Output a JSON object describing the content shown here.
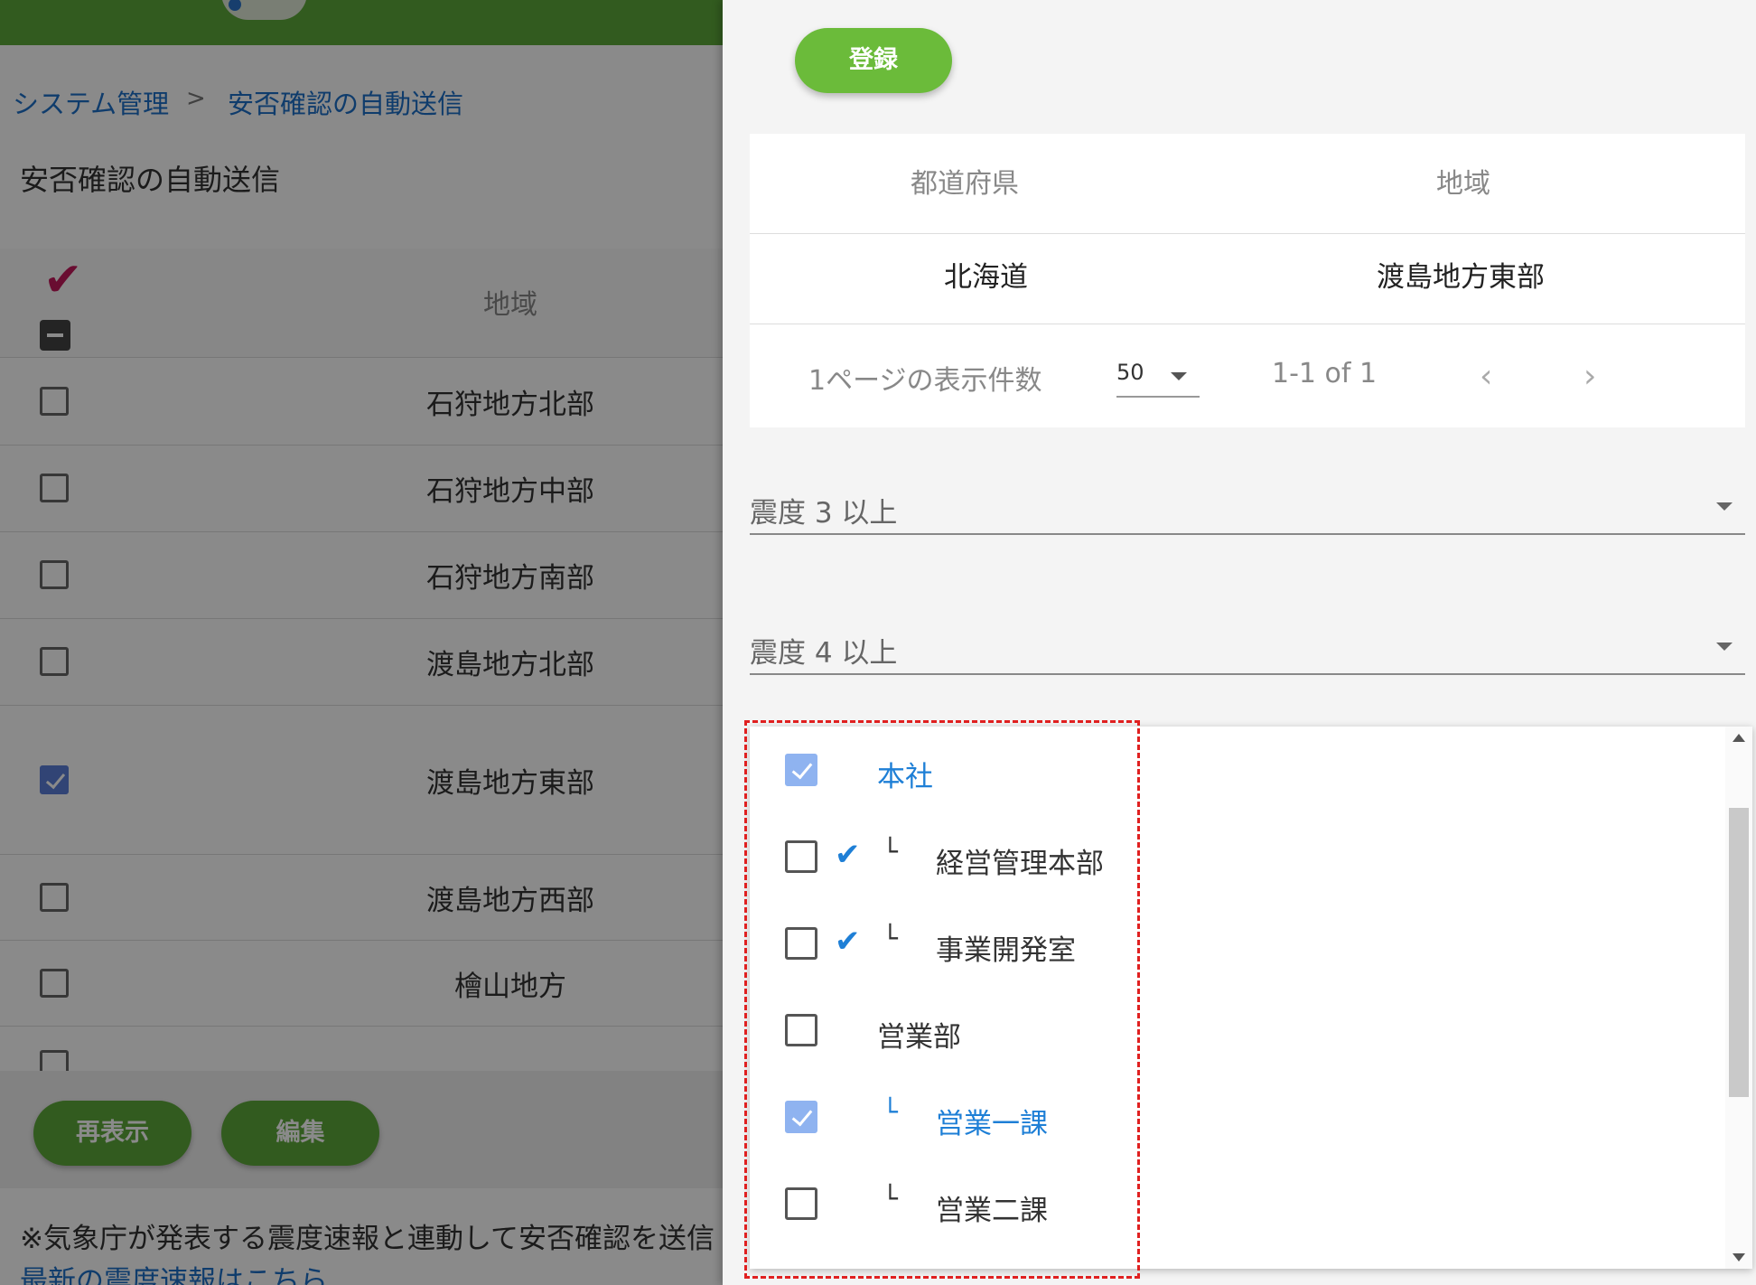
{
  "left": {
    "breadcrumb": [
      "システム管理",
      ">",
      "安否確認の自動送信"
    ],
    "page_title": "安否確認の自動送信",
    "table_header_region": "地域",
    "rows": [
      {
        "label": "石狩地方北部",
        "checked": false
      },
      {
        "label": "石狩地方中部",
        "checked": false
      },
      {
        "label": "石狩地方南部",
        "checked": false
      },
      {
        "label": "渡島地方北部",
        "checked": false
      },
      {
        "label": "渡島地方東部",
        "checked": true
      },
      {
        "label": "渡島地方西部",
        "checked": false
      },
      {
        "label": "檜山地方",
        "checked": false
      }
    ],
    "buttons": {
      "refresh": "再表示",
      "edit": "編集"
    },
    "note": "※気象庁が発表する震度速報と連動して安否確認を送信",
    "link": "最新の震度速報はこちら"
  },
  "right": {
    "register_button": "登録",
    "table": {
      "headers": [
        "都道府県",
        "地域"
      ],
      "rows": [
        [
          "北海道",
          "渡島地方東部"
        ]
      ],
      "rows_per_page_label": "1ページの表示件数",
      "rows_per_page_value": "50",
      "range": "1-1 of 1",
      "prev_icon": "‹",
      "next_icon": "›"
    },
    "selects": [
      "震度 3 以上",
      "震度 4 以上"
    ],
    "menu_items": [
      {
        "label": "本社",
        "checked": true,
        "auto_tick": false,
        "tree": "",
        "highlight": true
      },
      {
        "label": "経営管理本部",
        "checked": false,
        "auto_tick": true,
        "tree": "└",
        "highlight": false
      },
      {
        "label": "事業開発室",
        "checked": false,
        "auto_tick": true,
        "tree": "└",
        "highlight": false
      },
      {
        "label": "営業部",
        "checked": false,
        "auto_tick": false,
        "tree": "",
        "highlight": false
      },
      {
        "label": "営業一課",
        "checked": true,
        "auto_tick": false,
        "tree": "└",
        "highlight": true
      },
      {
        "label": "営業二課",
        "checked": false,
        "auto_tick": false,
        "tree": "└",
        "highlight": false
      }
    ]
  },
  "colors": {
    "brand_green": "#5da93a",
    "link_blue": "#1d6fc7",
    "check_pink": "#c2185b",
    "highlight_dashed_red": "#e02020"
  }
}
